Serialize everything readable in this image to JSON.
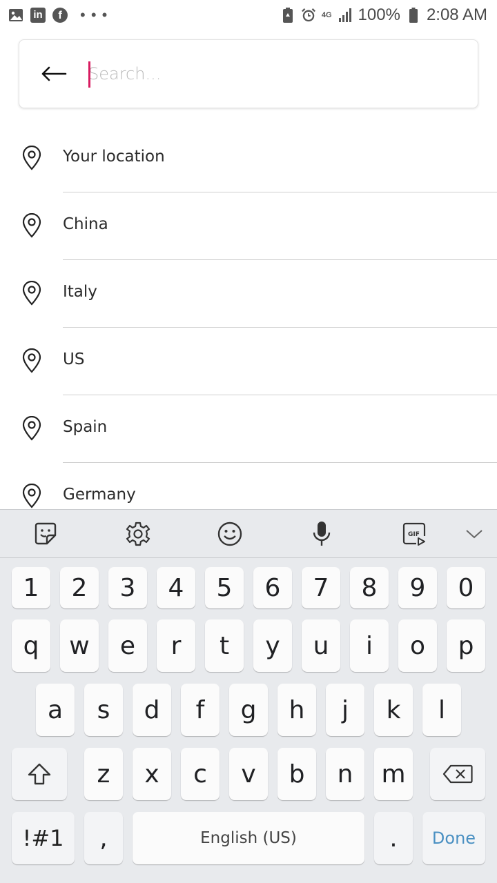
{
  "status_bar": {
    "left_icons": [
      "gallery-icon",
      "linkedin-icon",
      "facebook-icon",
      "more-dots-icon"
    ],
    "linkedin_text": "in",
    "facebook_text": "f",
    "more_text": "• • •",
    "network": "4G",
    "battery": "100%",
    "time": "2:08 AM"
  },
  "search": {
    "placeholder": "Search..."
  },
  "locations": [
    {
      "label": "Your location"
    },
    {
      "label": "China"
    },
    {
      "label": "Italy"
    },
    {
      "label": "US"
    },
    {
      "label": "Spain"
    },
    {
      "label": "Germany"
    }
  ],
  "keyboard": {
    "toolbar": [
      "sticker-icon",
      "gear-icon",
      "emoji-icon",
      "microphone-icon",
      "gif-icon",
      "chevron-down-icon"
    ],
    "gif_text": "GIF",
    "rows": {
      "numbers": [
        "1",
        "2",
        "3",
        "4",
        "5",
        "6",
        "7",
        "8",
        "9",
        "0"
      ],
      "row1": [
        "q",
        "w",
        "e",
        "r",
        "t",
        "y",
        "u",
        "i",
        "o",
        "p"
      ],
      "row2": [
        "a",
        "s",
        "d",
        "f",
        "g",
        "h",
        "j",
        "k",
        "l"
      ],
      "row3": [
        "z",
        "x",
        "c",
        "v",
        "b",
        "n",
        "m"
      ]
    },
    "symbols_label": "!#1",
    "comma_label": ",",
    "space_label": "English (US)",
    "period_label": ".",
    "done_label": "Done"
  },
  "colors": {
    "caret": "#d81b60",
    "done": "#4a90c2",
    "keyboard_bg": "#e8eaed"
  }
}
